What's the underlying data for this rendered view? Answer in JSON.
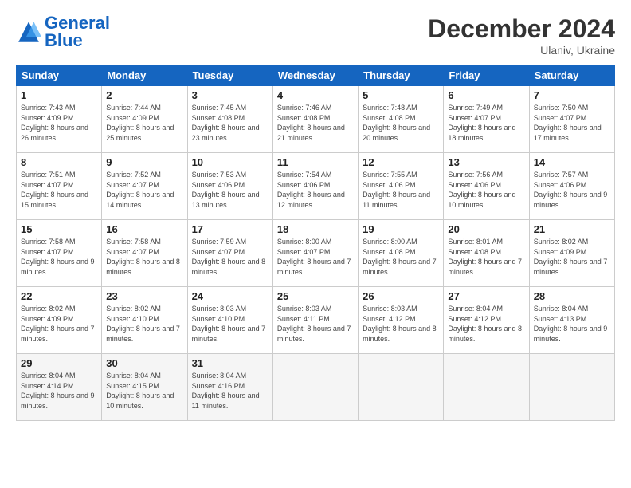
{
  "logo": {
    "line1": "General",
    "line2": "Blue"
  },
  "title": "December 2024",
  "subtitle": "Ulaniv, Ukraine",
  "days_header": [
    "Sunday",
    "Monday",
    "Tuesday",
    "Wednesday",
    "Thursday",
    "Friday",
    "Saturday"
  ],
  "weeks": [
    [
      {
        "day": "1",
        "sunrise": "7:43 AM",
        "sunset": "4:09 PM",
        "daylight": "8 hours and 26 minutes."
      },
      {
        "day": "2",
        "sunrise": "7:44 AM",
        "sunset": "4:09 PM",
        "daylight": "8 hours and 25 minutes."
      },
      {
        "day": "3",
        "sunrise": "7:45 AM",
        "sunset": "4:08 PM",
        "daylight": "8 hours and 23 minutes."
      },
      {
        "day": "4",
        "sunrise": "7:46 AM",
        "sunset": "4:08 PM",
        "daylight": "8 hours and 21 minutes."
      },
      {
        "day": "5",
        "sunrise": "7:48 AM",
        "sunset": "4:08 PM",
        "daylight": "8 hours and 20 minutes."
      },
      {
        "day": "6",
        "sunrise": "7:49 AM",
        "sunset": "4:07 PM",
        "daylight": "8 hours and 18 minutes."
      },
      {
        "day": "7",
        "sunrise": "7:50 AM",
        "sunset": "4:07 PM",
        "daylight": "8 hours and 17 minutes."
      }
    ],
    [
      {
        "day": "8",
        "sunrise": "7:51 AM",
        "sunset": "4:07 PM",
        "daylight": "8 hours and 15 minutes."
      },
      {
        "day": "9",
        "sunrise": "7:52 AM",
        "sunset": "4:07 PM",
        "daylight": "8 hours and 14 minutes."
      },
      {
        "day": "10",
        "sunrise": "7:53 AM",
        "sunset": "4:06 PM",
        "daylight": "8 hours and 13 minutes."
      },
      {
        "day": "11",
        "sunrise": "7:54 AM",
        "sunset": "4:06 PM",
        "daylight": "8 hours and 12 minutes."
      },
      {
        "day": "12",
        "sunrise": "7:55 AM",
        "sunset": "4:06 PM",
        "daylight": "8 hours and 11 minutes."
      },
      {
        "day": "13",
        "sunrise": "7:56 AM",
        "sunset": "4:06 PM",
        "daylight": "8 hours and 10 minutes."
      },
      {
        "day": "14",
        "sunrise": "7:57 AM",
        "sunset": "4:06 PM",
        "daylight": "8 hours and 9 minutes."
      }
    ],
    [
      {
        "day": "15",
        "sunrise": "7:58 AM",
        "sunset": "4:07 PM",
        "daylight": "8 hours and 9 minutes."
      },
      {
        "day": "16",
        "sunrise": "7:58 AM",
        "sunset": "4:07 PM",
        "daylight": "8 hours and 8 minutes."
      },
      {
        "day": "17",
        "sunrise": "7:59 AM",
        "sunset": "4:07 PM",
        "daylight": "8 hours and 8 minutes."
      },
      {
        "day": "18",
        "sunrise": "8:00 AM",
        "sunset": "4:07 PM",
        "daylight": "8 hours and 7 minutes."
      },
      {
        "day": "19",
        "sunrise": "8:00 AM",
        "sunset": "4:08 PM",
        "daylight": "8 hours and 7 minutes."
      },
      {
        "day": "20",
        "sunrise": "8:01 AM",
        "sunset": "4:08 PM",
        "daylight": "8 hours and 7 minutes."
      },
      {
        "day": "21",
        "sunrise": "8:02 AM",
        "sunset": "4:09 PM",
        "daylight": "8 hours and 7 minutes."
      }
    ],
    [
      {
        "day": "22",
        "sunrise": "8:02 AM",
        "sunset": "4:09 PM",
        "daylight": "8 hours and 7 minutes."
      },
      {
        "day": "23",
        "sunrise": "8:02 AM",
        "sunset": "4:10 PM",
        "daylight": "8 hours and 7 minutes."
      },
      {
        "day": "24",
        "sunrise": "8:03 AM",
        "sunset": "4:10 PM",
        "daylight": "8 hours and 7 minutes."
      },
      {
        "day": "25",
        "sunrise": "8:03 AM",
        "sunset": "4:11 PM",
        "daylight": "8 hours and 7 minutes."
      },
      {
        "day": "26",
        "sunrise": "8:03 AM",
        "sunset": "4:12 PM",
        "daylight": "8 hours and 8 minutes."
      },
      {
        "day": "27",
        "sunrise": "8:04 AM",
        "sunset": "4:12 PM",
        "daylight": "8 hours and 8 minutes."
      },
      {
        "day": "28",
        "sunrise": "8:04 AM",
        "sunset": "4:13 PM",
        "daylight": "8 hours and 9 minutes."
      }
    ],
    [
      {
        "day": "29",
        "sunrise": "8:04 AM",
        "sunset": "4:14 PM",
        "daylight": "8 hours and 9 minutes."
      },
      {
        "day": "30",
        "sunrise": "8:04 AM",
        "sunset": "4:15 PM",
        "daylight": "8 hours and 10 minutes."
      },
      {
        "day": "31",
        "sunrise": "8:04 AM",
        "sunset": "4:16 PM",
        "daylight": "8 hours and 11 minutes."
      },
      null,
      null,
      null,
      null
    ]
  ]
}
